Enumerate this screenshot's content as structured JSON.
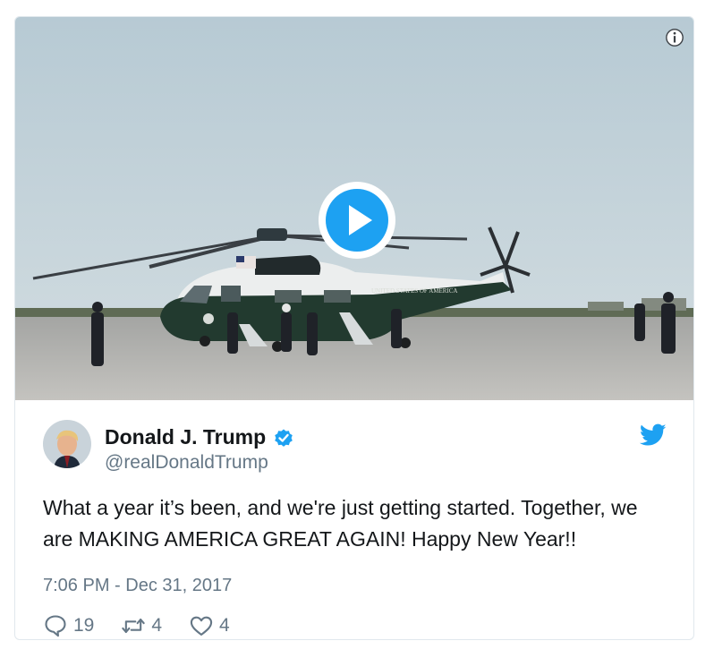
{
  "tweet": {
    "author": {
      "display_name": "Donald J. Trump",
      "handle": "@realDonaldTrump",
      "verified": true
    },
    "text": "What a year it’s been, and we're just getting started. Together, we are MAKING AMERICA GREAT AGAIN! Happy New Year!!",
    "timestamp": "7:06 PM - Dec 31, 2017",
    "stats": {
      "replies": "19",
      "retweets": "4",
      "likes": "4"
    }
  },
  "media": {
    "type": "video",
    "helicopter_marking": "UNITED STATES OF AMERICA"
  },
  "icons": {
    "info": "info-icon",
    "play": "play-icon",
    "verified": "verified-badge-icon",
    "brand": "twitter-bird-icon",
    "reply": "reply-icon",
    "retweet": "retweet-icon",
    "like": "heart-icon"
  },
  "colors": {
    "brand_blue": "#1da1f2",
    "text_primary": "#14171a",
    "text_secondary": "#657786",
    "border": "#e1e8ed"
  }
}
